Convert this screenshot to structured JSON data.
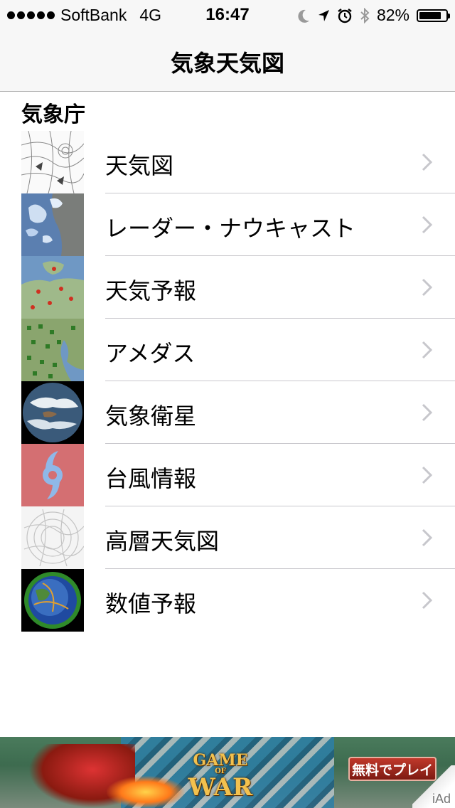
{
  "status_bar": {
    "carrier": "SoftBank",
    "network": "4G",
    "time": "16:47",
    "battery": "82%",
    "battery_level": 0.82,
    "icons": [
      "moon-icon",
      "location-arrow-icon",
      "alarm-icon",
      "bluetooth-icon",
      "battery-icon"
    ]
  },
  "nav": {
    "title": "気象天気図"
  },
  "section": {
    "title": "気象庁"
  },
  "items": [
    {
      "label": "天気図",
      "thumb": "weather-map-thumbnail"
    },
    {
      "label": "レーダー・ナウキャスト",
      "thumb": "radar-thumbnail"
    },
    {
      "label": "天気予報",
      "thumb": "forecast-map-thumbnail"
    },
    {
      "label": "アメダス",
      "thumb": "amedas-thumbnail"
    },
    {
      "label": "気象衛星",
      "thumb": "satellite-earth-thumbnail"
    },
    {
      "label": "台風情報",
      "thumb": "typhoon-thumbnail"
    },
    {
      "label": "高層天気図",
      "thumb": "upper-air-map-thumbnail"
    },
    {
      "label": "数値予報",
      "thumb": "numerical-forecast-thumbnail"
    }
  ],
  "ad": {
    "logo_line1": "GAME",
    "logo_line2": "OF",
    "logo_line3": "WAR",
    "cta": "無料でプレイ",
    "badge": "iAd"
  },
  "colors": {
    "separator": "#c8c7cc",
    "chevron": "#c7c7cc",
    "bar_background": "#f7f7f7",
    "typhoon_bg": "#d46f72",
    "typhoon_symbol": "#8fb8e8"
  }
}
